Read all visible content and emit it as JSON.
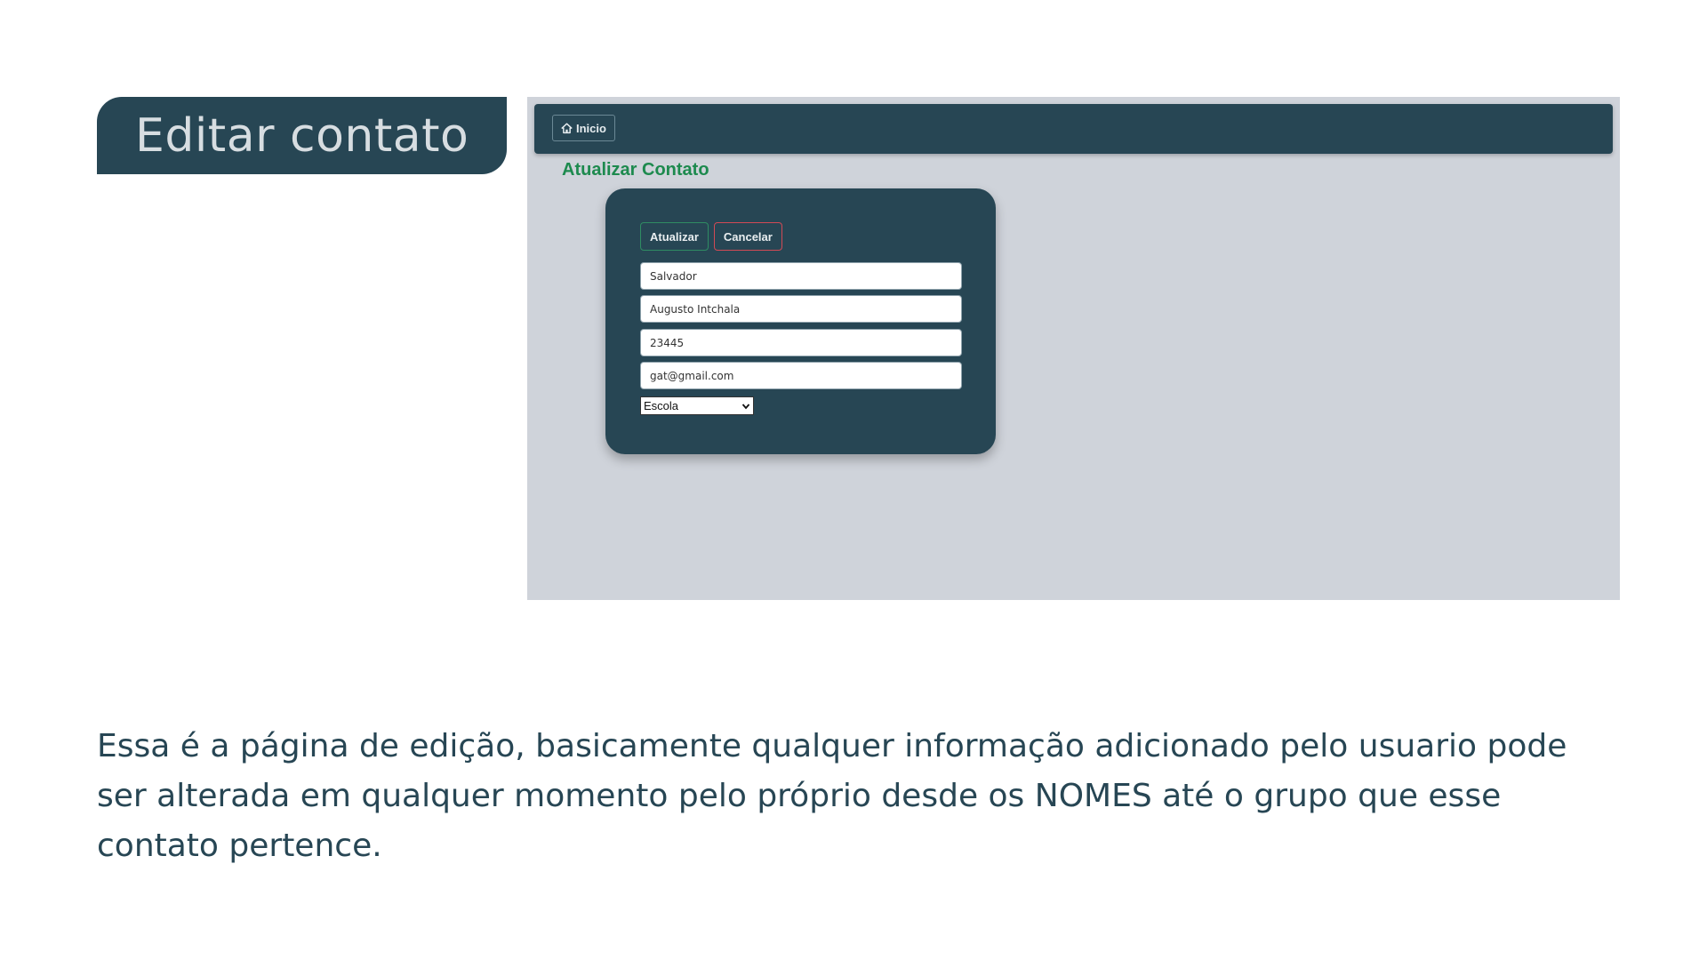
{
  "slide": {
    "title": "Editar contato",
    "description": "Essa é a página de edição, basicamente qualquer informação adicionado pelo usuario pode ser alterada em qualquer momento pelo próprio desde os NOMES até o grupo que esse contato pertence."
  },
  "app": {
    "navbar": {
      "home_label": "Inicio",
      "home_icon": "home-icon"
    },
    "heading": "Atualizar Contato",
    "form": {
      "update_label": "Atualizar",
      "cancel_label": "Cancelar",
      "first_name": "Salvador",
      "last_name": "Augusto Intchala",
      "phone": "23445",
      "email": "gat@gmail.com",
      "group_selected": "Escola"
    }
  },
  "colors": {
    "primary_dark": "#274654",
    "accent_green": "#1d8a4e",
    "cancel_red": "#d14a55",
    "screenshot_bg": "#cfd3da"
  }
}
